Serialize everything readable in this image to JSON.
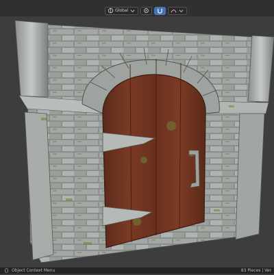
{
  "header": {
    "orientation_label": "Global",
    "icons": [
      "transform-orientation-icon",
      "pivot-icon",
      "snap-icon",
      "proportional-edit-icon"
    ]
  },
  "viewport": {
    "object": "stone-archway-wooden-door"
  },
  "statusbar": {
    "left_label": "Object Context Menu",
    "right_label": "83 Pieces | Ver"
  },
  "colors": {
    "background": "#3d3d3d",
    "topbar": "#303030",
    "statusbar": "#232323",
    "accent": "#4772b3"
  }
}
